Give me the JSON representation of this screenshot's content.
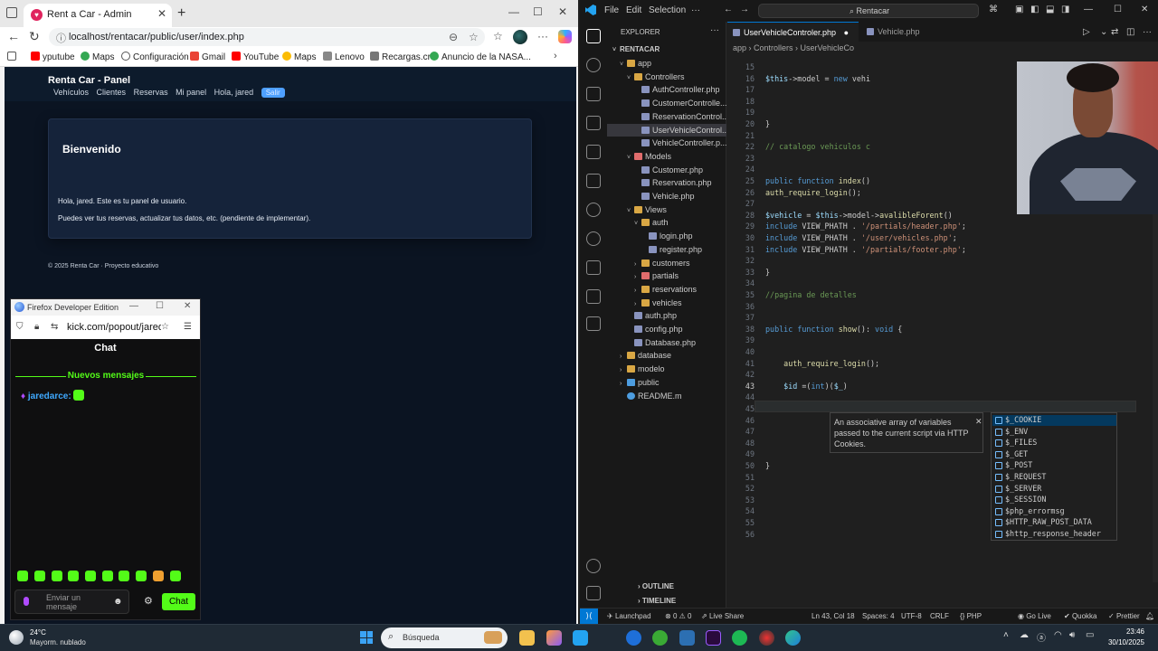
{
  "browser": {
    "tab_title": "Rent a Car - Admin",
    "url": "localhost/rentacar/public/user/index.php",
    "bookmarks": [
      "yputube",
      "Maps",
      "Configuración",
      "Gmail",
      "YouTube",
      "Maps",
      "Lenovo",
      "Recargas.cr",
      "Anuncio de la NASA..."
    ]
  },
  "site": {
    "brand": "Renta Car - Panel",
    "nav": [
      "Vehículos",
      "Clientes",
      "Reservas",
      "Mi panel",
      "Hola, jared"
    ],
    "nav_pill": "Salir",
    "card_title": "Bienvenido",
    "card_line1": "Hola, jared. Este es tu panel de usuario.",
    "card_line2": "Puedes ver tus reservas, actualizar tus datos, etc. (pendiente de implementar).",
    "footer": "© 2025 Renta Car · Proyecto educativo"
  },
  "firefox": {
    "title": "Firefox Developer Edition",
    "url": "kick.com/popout/jaredar",
    "chat_title": "Chat",
    "new_messages": "Nuevos mensajes",
    "msg_user": "jaredarce:",
    "input_placeholder_1": "Enviar un",
    "input_placeholder_2": "mensaje",
    "send_label": "Chat"
  },
  "vscode": {
    "menu": [
      "File",
      "Edit",
      "Selection",
      "···"
    ],
    "command_center": "Rentacar",
    "explorer_title": "EXPLORER",
    "root": "RENTACAR",
    "tree": [
      {
        "label": "app",
        "indent": 1,
        "type": "folder",
        "chev": "˅"
      },
      {
        "label": "Controllers",
        "indent": 2,
        "type": "folder",
        "chev": "˅"
      },
      {
        "label": "AuthController.php",
        "indent": 3,
        "type": "php",
        "chev": ""
      },
      {
        "label": "CustomerControlle...",
        "indent": 3,
        "type": "php",
        "chev": ""
      },
      {
        "label": "ReservationControl...",
        "indent": 3,
        "type": "php",
        "chev": ""
      },
      {
        "label": "UserVehicleControl...",
        "indent": 3,
        "type": "php",
        "chev": "",
        "selected": true
      },
      {
        "label": "VehicleController.p...",
        "indent": 3,
        "type": "php",
        "chev": ""
      },
      {
        "label": "Models",
        "indent": 2,
        "type": "folder-red",
        "chev": "˅"
      },
      {
        "label": "Customer.php",
        "indent": 3,
        "type": "php",
        "chev": ""
      },
      {
        "label": "Reservation.php",
        "indent": 3,
        "type": "php",
        "chev": ""
      },
      {
        "label": "Vehicle.php",
        "indent": 3,
        "type": "php",
        "chev": ""
      },
      {
        "label": "Views",
        "indent": 2,
        "type": "folder",
        "chev": "˅"
      },
      {
        "label": "auth",
        "indent": 3,
        "type": "folder",
        "chev": "˅"
      },
      {
        "label": "login.php",
        "indent": 4,
        "type": "php",
        "chev": ""
      },
      {
        "label": "register.php",
        "indent": 4,
        "type": "php",
        "chev": ""
      },
      {
        "label": "customers",
        "indent": 3,
        "type": "folder",
        "chev": "›"
      },
      {
        "label": "partials",
        "indent": 3,
        "type": "folder-red",
        "chev": "›"
      },
      {
        "label": "reservations",
        "indent": 3,
        "type": "folder",
        "chev": "›"
      },
      {
        "label": "vehicles",
        "indent": 3,
        "type": "folder",
        "chev": "›"
      },
      {
        "label": "auth.php",
        "indent": 2,
        "type": "php",
        "chev": ""
      },
      {
        "label": "config.php",
        "indent": 2,
        "type": "php",
        "chev": ""
      },
      {
        "label": "Database.php",
        "indent": 2,
        "type": "php",
        "chev": ""
      },
      {
        "label": "database",
        "indent": 1,
        "type": "folder",
        "chev": "›"
      },
      {
        "label": "modelo",
        "indent": 1,
        "type": "folder",
        "chev": "›"
      },
      {
        "label": "public",
        "indent": 1,
        "type": "folder-blue",
        "chev": "›"
      },
      {
        "label": "README.m",
        "indent": 1,
        "type": "info",
        "chev": ""
      }
    ],
    "outline": "OUTLINE",
    "timeline": "TIMELINE",
    "tab_active": "UserVehicleControler.php",
    "tab_inactive": "Vehicle.php",
    "breadcrumb": "app  ›  Controllers  ›  UserVehicleCo",
    "code": [
      {
        "n": "15",
        "t": ""
      },
      {
        "n": "16",
        "t": "$this->model = new vehi"
      },
      {
        "n": "17",
        "t": ""
      },
      {
        "n": "18",
        "t": ""
      },
      {
        "n": "19",
        "t": ""
      },
      {
        "n": "20",
        "t": "}"
      },
      {
        "n": "21",
        "t": ""
      },
      {
        "n": "22",
        "t": "// catalogo vehiculos c"
      },
      {
        "n": "23",
        "t": ""
      },
      {
        "n": "24",
        "t": ""
      },
      {
        "n": "25",
        "t": "public function index()"
      },
      {
        "n": "26",
        "t": "auth_require_login();"
      },
      {
        "n": "27",
        "t": ""
      },
      {
        "n": "28",
        "t": "$vehicle = $this->model->avalibleForent()"
      },
      {
        "n": "29",
        "t": "include VIEW_PHATH . '/partials/header.php';"
      },
      {
        "n": "30",
        "t": "include VIEW_PHATH . '/user/vehicles.php';"
      },
      {
        "n": "31",
        "t": "include VIEW_PHATH . '/partials/footer.php';"
      },
      {
        "n": "32",
        "t": ""
      },
      {
        "n": "33",
        "t": "}"
      },
      {
        "n": "34",
        "t": ""
      },
      {
        "n": "35",
        "t": "//pagina de detalles"
      },
      {
        "n": "36",
        "t": ""
      },
      {
        "n": "37",
        "t": ""
      },
      {
        "n": "38",
        "t": "public function show(): void {"
      },
      {
        "n": "39",
        "t": ""
      },
      {
        "n": "40",
        "t": ""
      },
      {
        "n": "41",
        "t": "    auth_require_login();"
      },
      {
        "n": "42",
        "t": ""
      },
      {
        "n": "43",
        "t": "    $id =(int)($_)"
      },
      {
        "n": "44",
        "t": ""
      },
      {
        "n": "45",
        "t": ""
      },
      {
        "n": "46",
        "t": ""
      },
      {
        "n": "47",
        "t": ""
      },
      {
        "n": "48",
        "t": ""
      },
      {
        "n": "49",
        "t": ""
      },
      {
        "n": "50",
        "t": "}"
      },
      {
        "n": "51",
        "t": ""
      },
      {
        "n": "52",
        "t": ""
      },
      {
        "n": "53",
        "t": ""
      },
      {
        "n": "54",
        "t": ""
      },
      {
        "n": "55",
        "t": ""
      },
      {
        "n": "56",
        "t": ""
      }
    ],
    "hover_text": "An associative array of variables passed to the current script via HTTP Cookies.",
    "suggestions": [
      "$_COOKIE",
      "$_ENV",
      "$_FILES",
      "$_GET",
      "$_POST",
      "$_REQUEST",
      "$_SERVER",
      "$_SESSION",
      "$php_errormsg",
      "$HTTP_RAW_POST_DATA",
      "$http_response_header"
    ],
    "status": {
      "launchpad": "Launchpad",
      "errors": "0",
      "warnings": "0",
      "live_share": "Live Share",
      "position": "Ln 43, Col 18",
      "spaces": "Spaces: 4",
      "encoding": "UTF-8",
      "eol": "CRLF",
      "language": "PHP",
      "go_live": "Go Live",
      "quokka": "Quokka",
      "prettier": "Prettier"
    }
  },
  "taskbar": {
    "temp": "24°C",
    "weather": "Mayorm. nublado",
    "search": "Búsqueda",
    "time": "23:46",
    "date": "30/10/2025"
  }
}
